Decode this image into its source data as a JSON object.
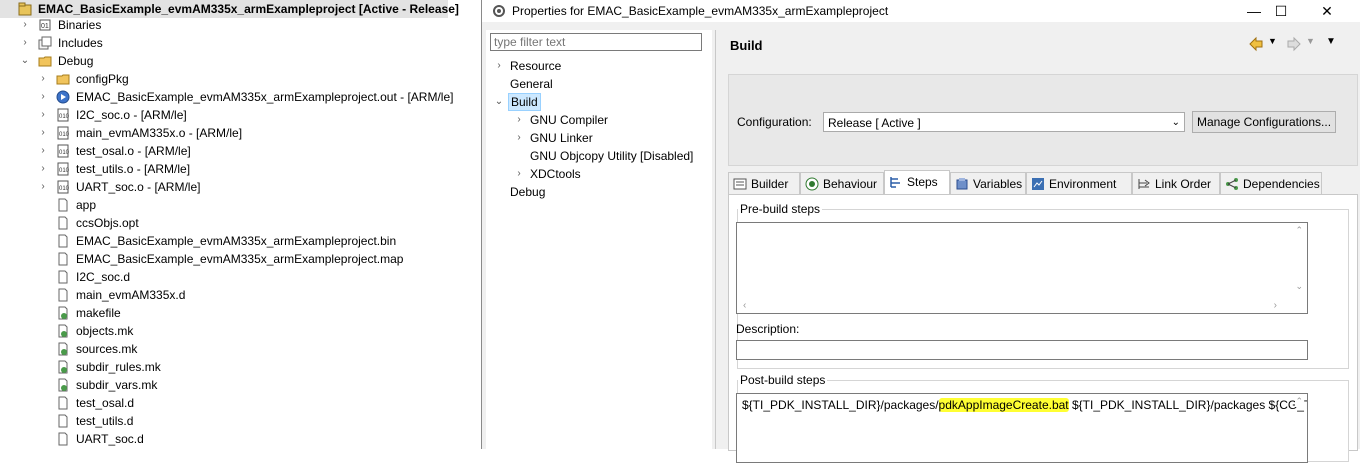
{
  "explorer": {
    "project_label": "EMAC_BasicExample_evmAM335x_armExampleproject  [Active - Release]",
    "items": [
      {
        "label": "Binaries",
        "icon": "binaries-icon"
      },
      {
        "label": "Includes",
        "icon": "includes-icon"
      },
      {
        "label": "Debug",
        "icon": "folder-open-icon"
      },
      {
        "label": "configPkg",
        "icon": "folder-icon"
      },
      {
        "label": "EMAC_BasicExample_evmAM335x_armExampleproject.out - [ARM/le]",
        "icon": "executable-icon"
      },
      {
        "label": "I2C_soc.o - [ARM/le]",
        "icon": "object-file-icon"
      },
      {
        "label": "main_evmAM335x.o - [ARM/le]",
        "icon": "object-file-icon"
      },
      {
        "label": "test_osal.o - [ARM/le]",
        "icon": "object-file-icon"
      },
      {
        "label": "test_utils.o - [ARM/le]",
        "icon": "object-file-icon"
      },
      {
        "label": "UART_soc.o - [ARM/le]",
        "icon": "object-file-icon"
      },
      {
        "label": "app",
        "icon": "file-icon"
      },
      {
        "label": "ccsObjs.opt",
        "icon": "file-icon"
      },
      {
        "label": "EMAC_BasicExample_evmAM335x_armExampleproject.bin",
        "icon": "file-icon"
      },
      {
        "label": "EMAC_BasicExample_evmAM335x_armExampleproject.map",
        "icon": "file-icon"
      },
      {
        "label": "I2C_soc.d",
        "icon": "file-icon"
      },
      {
        "label": "main_evmAM335x.d",
        "icon": "file-icon"
      },
      {
        "label": "makefile",
        "icon": "makefile-icon"
      },
      {
        "label": "objects.mk",
        "icon": "makefile-icon"
      },
      {
        "label": "sources.mk",
        "icon": "makefile-icon"
      },
      {
        "label": "subdir_rules.mk",
        "icon": "makefile-icon"
      },
      {
        "label": "subdir_vars.mk",
        "icon": "makefile-icon"
      },
      {
        "label": "test_osal.d",
        "icon": "file-icon"
      },
      {
        "label": "test_utils.d",
        "icon": "file-icon"
      },
      {
        "label": "UART_soc.d",
        "icon": "file-icon"
      }
    ]
  },
  "dialog": {
    "title": "Properties for EMAC_BasicExample_evmAM335x_armExampleproject",
    "filter_placeholder": "type filter text",
    "nav": [
      {
        "label": "Resource"
      },
      {
        "label": "General"
      },
      {
        "label": "Build"
      },
      {
        "label": "GNU Compiler"
      },
      {
        "label": "GNU Linker"
      },
      {
        "label": "GNU Objcopy Utility  [Disabled]"
      },
      {
        "label": "XDCtools"
      },
      {
        "label": "Debug"
      }
    ],
    "section_title": "Build",
    "configuration_label": "Configuration:",
    "configuration_value": "Release  [ Active ]",
    "manage_button": "Manage Configurations...",
    "tabs": [
      {
        "label": "Builder",
        "icon": "builder-icon"
      },
      {
        "label": "Behaviour",
        "icon": "behaviour-icon"
      },
      {
        "label": "Steps",
        "icon": "steps-icon"
      },
      {
        "label": "Variables",
        "icon": "variables-icon"
      },
      {
        "label": "Environment",
        "icon": "environment-icon"
      },
      {
        "label": "Link Order",
        "icon": "link-order-icon"
      },
      {
        "label": "Dependencies",
        "icon": "dependencies-icon"
      }
    ],
    "active_tab": "Steps",
    "prebuild_label": "Pre-build steps",
    "description_label": "Description:",
    "postbuild_label": "Post-build steps",
    "postbuild_prefix": "${TI_PDK_INSTALL_DIR}/packages/",
    "postbuild_highlight": "pdkAppImageCreate.bat",
    "postbuild_suffix": " ${TI_PDK_INSTALL_DIR}/packages ${CG_TO",
    "highlight_color": "#ffff33"
  }
}
